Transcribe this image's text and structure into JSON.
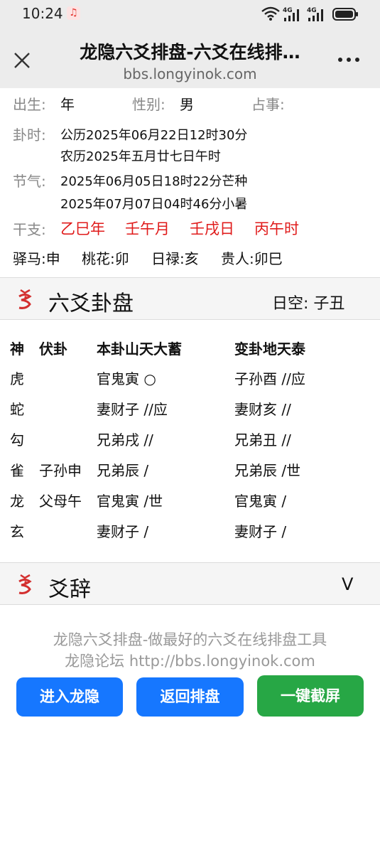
{
  "status": {
    "time": "10:24",
    "net1": "4G",
    "net2": "4G"
  },
  "header": {
    "title": "龙隐六爻排盘-六爻在线排…",
    "url": "bbs.longyinok.com"
  },
  "info": {
    "birth_label": "出生:",
    "birth_value": "年",
    "gender_label": "性别:",
    "gender_value": "男",
    "matter_label": "占事:",
    "time_label": "卦时:",
    "time_solar": "公历2025年06月22日12时30分",
    "time_lunar": "农历2025年五月廿七日午时",
    "jieqi_label": "节气:",
    "jieqi_1": "2025年06月05日18时22分芒种",
    "jieqi_2": "2025年07月07日04时46分小暑",
    "ganzhi_label": "干支:",
    "ganzhi": [
      "乙巳年",
      "壬午月",
      "壬戌日",
      "丙午时"
    ],
    "shensha": [
      "驿马:申",
      "桃花:卯",
      "日禄:亥",
      "贵人:卯巳"
    ]
  },
  "gua_section": {
    "title": "六爻卦盘",
    "rikong": "日空: 子丑",
    "headers": {
      "shen": "神",
      "fu": "伏卦",
      "ben": "本卦山天大蓄",
      "bian": "变卦地天泰"
    },
    "rows": [
      {
        "shen": "虎",
        "fu": "",
        "ben": "官鬼寅 ○",
        "bian": "子孙酉 //应"
      },
      {
        "shen": "蛇",
        "fu": "",
        "ben": "妻财子 //应",
        "bian": "妻财亥 //"
      },
      {
        "shen": "勾",
        "fu": "",
        "ben": "兄弟戌 //",
        "bian": "兄弟丑 //"
      },
      {
        "shen": "雀",
        "fu": "子孙申",
        "ben": "兄弟辰 /",
        "bian": "兄弟辰 /世"
      },
      {
        "shen": "龙",
        "fu": "父母午",
        "ben": "官鬼寅 /世",
        "bian": "官鬼寅 /"
      },
      {
        "shen": "玄",
        "fu": "",
        "ben": "妻财子 /",
        "bian": "妻财子 /"
      }
    ]
  },
  "yaoci_section": {
    "title": "爻辞",
    "toggle": "V"
  },
  "footer": {
    "line1": "龙隐六爻排盘-做最好的六爻在线排盘工具",
    "line2": "龙隐论坛 http://bbs.longyinok.com",
    "buttons": {
      "enter": "进入龙隐",
      "back": "返回排盘",
      "screenshot": "一键截屏"
    }
  },
  "colors": {
    "accent_blue": "#1677ff",
    "accent_green": "#27a745",
    "ganzhi_red": "#e01b1b",
    "dragon_red": "#d32f2f"
  },
  "icons": {
    "close": "close-icon",
    "more": "more-icon",
    "section": "dragon-logo-icon"
  }
}
